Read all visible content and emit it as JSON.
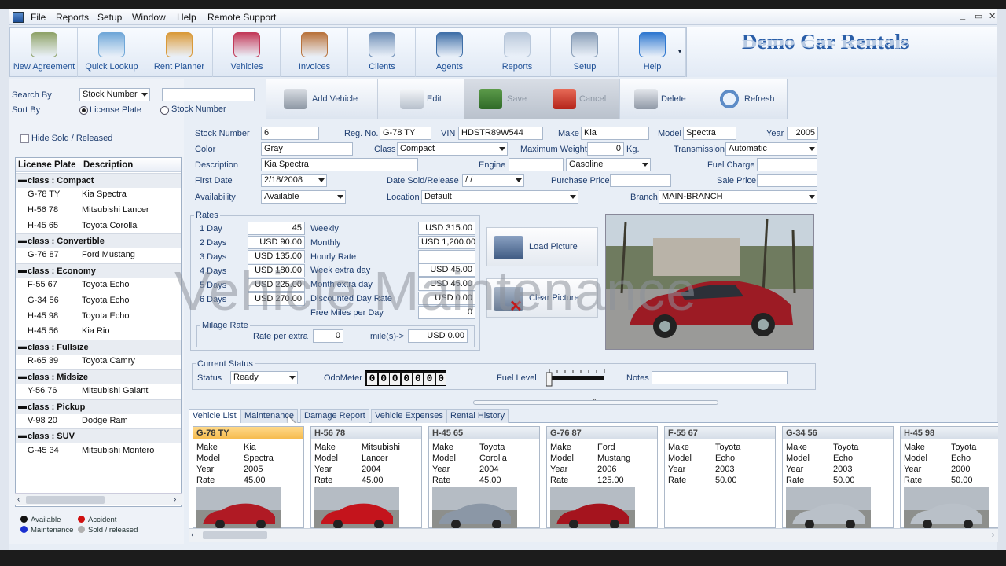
{
  "menu": {
    "items": [
      "File",
      "Reports",
      "Setup",
      "Window",
      "Help",
      "Remote Support"
    ],
    "window_controls": [
      "_",
      "▭",
      "✕"
    ]
  },
  "toolbar": {
    "buttons": [
      {
        "label": "New Agreement",
        "icon": "new-agreement-icon"
      },
      {
        "label": "Quick Lookup",
        "icon": "quick-lookup-icon"
      },
      {
        "label": "Rent Planner",
        "icon": "rent-planner-icon"
      },
      {
        "label": "Vehicles",
        "icon": "vehicles-icon"
      },
      {
        "label": "Invoices",
        "icon": "invoices-icon"
      },
      {
        "label": "Clients",
        "icon": "clients-icon"
      },
      {
        "label": "Agents",
        "icon": "agents-icon"
      },
      {
        "label": "Reports",
        "icon": "reports-icon"
      },
      {
        "label": "Setup",
        "icon": "setup-icon"
      },
      {
        "label": "Help",
        "icon": "help-icon"
      }
    ]
  },
  "brand": {
    "title": "Demo Car Rentals"
  },
  "search": {
    "search_by_label": "Search By",
    "search_by_value": "Stock Number",
    "search_value": "",
    "sort_by_label": "Sort By",
    "sort_license": "License Plate",
    "sort_stock": "Stock Number",
    "hide_sold": "Hide Sold / Released"
  },
  "tree": {
    "headers": [
      "License Plate",
      "Description"
    ],
    "groups": [
      {
        "name": "class : Compact",
        "rows": [
          [
            "G-78 TY",
            "Kia Spectra"
          ],
          [
            "H-56 78",
            "Mitsubishi Lancer"
          ],
          [
            "H-45 65",
            "Toyota Corolla"
          ]
        ]
      },
      {
        "name": "class : Convertible",
        "rows": [
          [
            "G-76 87",
            "Ford Mustang"
          ]
        ]
      },
      {
        "name": "class : Economy",
        "rows": [
          [
            "F-55 67",
            "Toyota Echo"
          ],
          [
            "G-34 56",
            "Toyota Echo"
          ],
          [
            "H-45 98",
            "Toyota Echo"
          ],
          [
            "H-45 56",
            "Kia Rio"
          ]
        ]
      },
      {
        "name": "class : Fullsize",
        "rows": [
          [
            "R-65 39",
            "Toyota Camry"
          ]
        ]
      },
      {
        "name": "class : Midsize",
        "rows": [
          [
            "Y-56 76",
            "Mitsubishi Galant"
          ]
        ]
      },
      {
        "name": "class : Pickup",
        "rows": [
          [
            "V-98 20",
            "Dodge Ram"
          ]
        ]
      },
      {
        "name": "class : SUV",
        "rows": [
          [
            "G-45 34",
            "Mitsubishi Montero"
          ]
        ]
      }
    ]
  },
  "legend": {
    "available": "Available",
    "accident": "Accident",
    "maintenance": "Maintenance",
    "sold": "Sold / released",
    "colors": {
      "available": "#111111",
      "accident": "#d01010",
      "maintenance": "#1a2fd0",
      "sold": "#b0b0b0"
    }
  },
  "actions": {
    "add": "Add Vehicle",
    "edit": "Edit",
    "save": "Save",
    "cancel": "Cancel",
    "delete": "Delete",
    "refresh": "Refresh"
  },
  "form": {
    "stock_number_label": "Stock Number",
    "stock_number": "6",
    "reg_label": "Reg. No.",
    "reg": "G-78 TY",
    "vin_label": "VIN",
    "vin": "HDSTR89W544",
    "make_label": "Make",
    "make": "Kia",
    "model_label": "Model",
    "model": "Spectra",
    "year_label": "Year",
    "year": "2005",
    "color_label": "Color",
    "color": "Gray",
    "class_label": "Class",
    "class": "Compact",
    "max_weight_label": "Maximum Weight",
    "max_weight": "0",
    "kg": "Kg.",
    "transmission_label": "Transmission",
    "transmission": "Automatic",
    "description_label": "Description",
    "description": "Kia Spectra",
    "engine_label": "Engine",
    "engine": "",
    "fuel_type": "Gasoline",
    "fuel_charge_label": "Fuel Charge",
    "fuel_charge": "",
    "first_date_label": "First Date",
    "first_date": "2/18/2008",
    "date_sold_label": "Date Sold/Release",
    "date_sold": " / /",
    "purchase_price_label": "Purchase Price",
    "purchase_price": "",
    "sale_price_label": "Sale Price",
    "sale_price": "",
    "availability_label": "Availability",
    "availability": "Available",
    "location_label": "Location",
    "location": "Default",
    "branch_label": "Branch",
    "branch": "MAIN-BRANCH"
  },
  "rates": {
    "title": "Rates",
    "left": [
      {
        "label": "1 Day",
        "value": "45"
      },
      {
        "label": "2 Days",
        "value": "USD 90.00"
      },
      {
        "label": "3 Days",
        "value": "USD 135.00"
      },
      {
        "label": "4 Days",
        "value": "USD 180.00"
      },
      {
        "label": "5 Days",
        "value": "USD 225.00"
      },
      {
        "label": "6 Days",
        "value": "USD 270.00"
      }
    ],
    "right": [
      {
        "label": "Weekly",
        "value": "USD 315.00"
      },
      {
        "label": "Monthly",
        "value": "USD 1,200.00"
      },
      {
        "label": "Hourly Rate",
        "value": ""
      },
      {
        "label": "Week extra day",
        "value": "USD 45.00"
      },
      {
        "label": "Month extra day",
        "value": "USD 45.00"
      },
      {
        "label": "Discounted Day Rate",
        "value": "USD 0.00"
      },
      {
        "label": "Free Miles per Day",
        "value": "0"
      }
    ],
    "mileage_title": "Milage Rate",
    "rate_per_extra_label": "Rate per extra",
    "rate_per_extra": "0",
    "miles_label": "mile(s)->",
    "miles_value": "USD 0.00"
  },
  "picture": {
    "load": "Load Picture",
    "clear": "Clear Picture"
  },
  "status": {
    "title": "Current Status",
    "status_label": "Status",
    "status": "Ready",
    "odometer_label": "OdoMeter",
    "odometer": "0000000",
    "fuel_label": "Fuel Level",
    "notes_label": "Notes",
    "notes": ""
  },
  "tabs": [
    "Vehicle List",
    "Maintenance",
    "Damage Report",
    "Vehicle Expenses",
    "Rental History"
  ],
  "card_keys": [
    "Make",
    "Model",
    "Year",
    "Rate"
  ],
  "cards": [
    {
      "plate": "G-78 TY",
      "make": "Kia",
      "model": "Spectra",
      "year": "2005",
      "rate": "45.00",
      "selected": true,
      "car": "#b01a24"
    },
    {
      "plate": "H-56 78",
      "make": "Mitsubishi",
      "model": "Lancer",
      "year": "2004",
      "rate": "45.00",
      "car": "#c4141c"
    },
    {
      "plate": "H-45 65",
      "make": "Toyota",
      "model": "Corolla",
      "year": "2004",
      "rate": "45.00",
      "car": "#8b97a6"
    },
    {
      "plate": "G-76 87",
      "make": "Ford",
      "model": "Mustang",
      "year": "2006",
      "rate": "125.00",
      "car": "#a5141e"
    },
    {
      "plate": "F-55 67",
      "make": "Toyota",
      "model": "Echo",
      "year": "2003",
      "rate": "50.00",
      "car": ""
    },
    {
      "plate": "G-34 56",
      "make": "Toyota",
      "model": "Echo",
      "year": "2003",
      "rate": "50.00",
      "car": "#b9c0c8"
    },
    {
      "plate": "H-45 98",
      "make": "Toyota",
      "model": "Echo",
      "year": "2000",
      "rate": "50.00",
      "car": "#b9c0c8"
    }
  ],
  "watermark": "Vehicle Maintenance"
}
